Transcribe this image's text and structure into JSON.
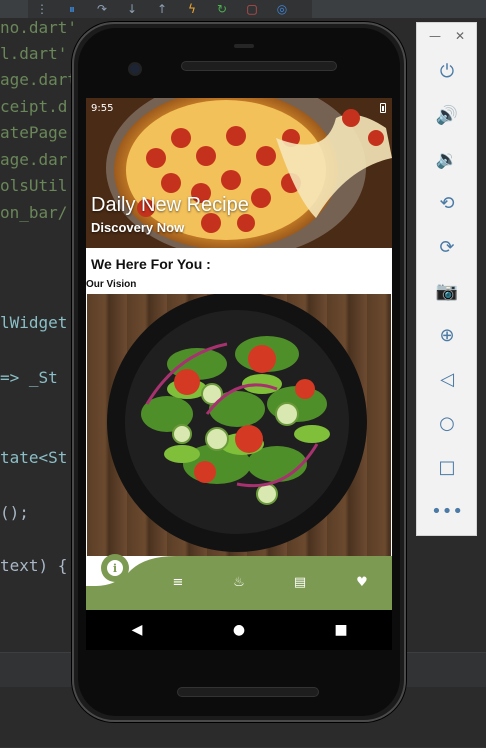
{
  "ide": {
    "toolbar_icons": [
      "drag-handle-icon",
      "pause-icon",
      "step-over-icon",
      "step-into-icon",
      "step-out-icon",
      "hot-reload-icon",
      "hot-restart-icon",
      "stop-icon",
      "inspect-icon"
    ],
    "code_lines": [
      {
        "text": "no.dart'"
      },
      {
        "text": "l.dart'"
      },
      {
        "text": "age.dart"
      },
      {
        "text": "ceipt.d"
      },
      {
        "text": "atePage"
      },
      {
        "text": "age.dar"
      },
      {
        "text": "olsUtil"
      },
      {
        "text": "on_bar/"
      },
      {
        "text": "lWidget"
      },
      {
        "text": "=> _St"
      },
      {
        "text": "tate<St"
      },
      {
        "text": "();"
      },
      {
        "text": "text) {"
      }
    ]
  },
  "phone": {
    "status": {
      "time": "9:55"
    },
    "hero": {
      "title": "Daily New Recipe",
      "subtitle": "Discovery Now"
    },
    "section": {
      "title": "We Here For You :",
      "subtitle": "Our Vision"
    },
    "bottom_nav": {
      "items": [
        {
          "icon": "info-icon",
          "active": true
        },
        {
          "icon": "menu-lines-icon",
          "active": false
        },
        {
          "icon": "flame-icon",
          "active": false
        },
        {
          "icon": "article-icon",
          "active": false
        },
        {
          "icon": "heart-icon",
          "active": false
        }
      ],
      "color": "#7d9a52"
    },
    "system_nav": [
      "back-icon",
      "home-icon",
      "overview-icon"
    ]
  },
  "emulator_panel": {
    "buttons": [
      "power-icon",
      "volume-up-icon",
      "volume-down-icon",
      "rotate-left-icon",
      "rotate-right-icon",
      "camera-icon",
      "zoom-icon",
      "back-icon",
      "home-icon",
      "overview-icon",
      "more-icon"
    ]
  }
}
